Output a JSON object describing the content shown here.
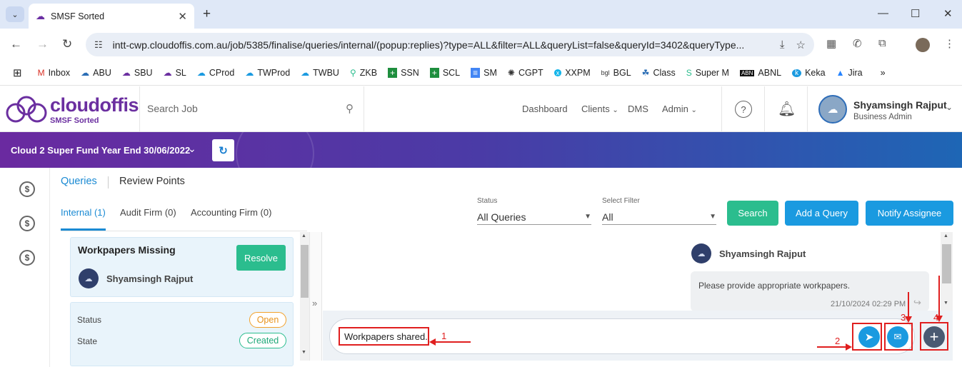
{
  "browser": {
    "tab_title": "SMSF Sorted",
    "url": "intt-cwp.cloudoffis.com.au/job/5385/finalise/queries/internal/(popup:replies)?type=ALL&filter=ALL&queryList=false&queryId=3402&queryType...",
    "bookmarks": [
      "Inbox",
      "ABU",
      "SBU",
      "SL",
      "CProd",
      "TWProd",
      "TWBU",
      "ZKB",
      "SSN",
      "SCL",
      "SM",
      "CGPT",
      "XXPM",
      "BGL",
      "Class",
      "Super M",
      "ABNL",
      "Keka",
      "Jira"
    ]
  },
  "header": {
    "logo_word": "cloudoffis",
    "logo_sub": "SMSF Sorted",
    "search_placeholder": "Search Job",
    "nav": {
      "dashboard": "Dashboard",
      "clients": "Clients",
      "dms": "DMS",
      "admin": "Admin"
    },
    "user_name": "Shyamsingh Rajput",
    "user_role": "Business Admin"
  },
  "banner": {
    "title": "Cloud 2 Super Fund Year End 30/06/2022"
  },
  "tabs": {
    "queries": "Queries",
    "review_points": "Review Points"
  },
  "subtabs": {
    "internal": "Internal (1)",
    "audit": "Audit Firm (0)",
    "accounting": "Accounting Firm (0)"
  },
  "filters": {
    "status_label": "Status",
    "status_value": "All Queries",
    "select_label": "Select Filter",
    "select_value": "All"
  },
  "buttons": {
    "search": "Search",
    "add_query": "Add a Query",
    "notify": "Notify Assignee",
    "resolve": "Resolve"
  },
  "query": {
    "title": "Workpapers Missing",
    "author": "Shyamsingh Rajput",
    "status_label": "Status",
    "status_value": "Open",
    "state_label": "State",
    "state_value": "Created"
  },
  "message": {
    "author": "Shyamsingh Rajput",
    "text": "Please provide appropriate workpapers.",
    "time": "21/10/2024 02:29 PM"
  },
  "composer": {
    "text": "Workpapers shared."
  },
  "annotations": {
    "n1": "1",
    "n2": "2",
    "n3": "3",
    "n4": "4"
  },
  "colors": {
    "brand_purple": "#6b2fa0",
    "accent_blue": "#1a9ae0",
    "success_green": "#2bbd8e",
    "annotation_red": "#e01f1f"
  }
}
